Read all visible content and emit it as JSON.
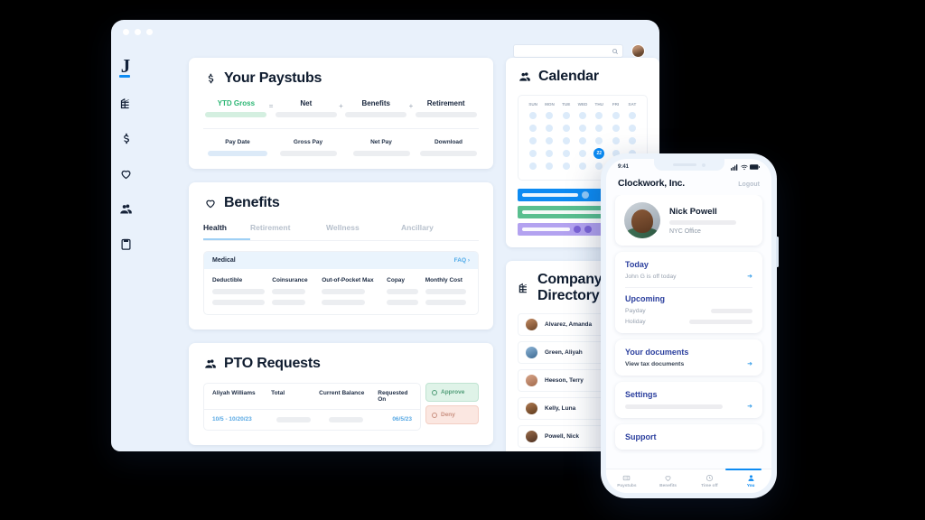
{
  "window": {
    "dots": 3
  },
  "sidebar": {
    "logo": "J",
    "items": [
      {
        "name": "company-icon",
        "label": "Company"
      },
      {
        "name": "payroll-icon",
        "label": "Payroll"
      },
      {
        "name": "benefits-icon",
        "label": "Benefits"
      },
      {
        "name": "time-off-icon",
        "label": "Time Off"
      },
      {
        "name": "documents-icon",
        "label": "Documents"
      }
    ]
  },
  "topbar": {
    "search_placeholder": "",
    "search_value": "",
    "search_icon": "search-icon",
    "avatar": "user-avatar"
  },
  "paystubs": {
    "icon": "dollar-icon",
    "title": "Your Paystubs",
    "summary": [
      {
        "label": "YTD Gross",
        "accent": "green",
        "op": ""
      },
      {
        "label": "Net",
        "accent": "",
        "op": "="
      },
      {
        "label": "Benefits",
        "accent": "",
        "op": "+"
      },
      {
        "label": "Retirement",
        "accent": "",
        "op": "+"
      }
    ],
    "table_headers": [
      "Pay Date",
      "Gross Pay",
      "Net Pay",
      "Download"
    ]
  },
  "benefits": {
    "icon": "heart-icon",
    "title": "Benefits",
    "tabs": [
      {
        "label": "Health",
        "active": true
      },
      {
        "label": "Retirement",
        "active": false
      },
      {
        "label": "Wellness",
        "active": false
      },
      {
        "label": "Ancillary",
        "active": false
      }
    ],
    "plan_row": {
      "name": "Medical",
      "faq": "FAQ",
      "chevron": "chevron-right-icon"
    },
    "columns": [
      "Deductible",
      "Coinsurance",
      "Out-of-Pocket Max",
      "Copay",
      "Monthly Cost"
    ]
  },
  "pto": {
    "icon": "pto-icon",
    "title": "PTO Requests",
    "headers": [
      "Aliyah Williams",
      "Total",
      "Current Balance",
      "Requested On"
    ],
    "row": {
      "dates": "10/5 - 10/20/23",
      "total": "",
      "balance": "",
      "requested_on": "06/5/23"
    },
    "approve_label": "Approve",
    "deny_label": "Deny"
  },
  "calendar": {
    "icon": "calendar-people-icon",
    "title": "Calendar",
    "dow": [
      "SUN",
      "MON",
      "TUE",
      "WED",
      "THU",
      "FRI",
      "SAT"
    ],
    "today": "22",
    "today_index": 25,
    "cells": 35,
    "events": [
      {
        "color": "#0d8bf2",
        "pips": 1
      },
      {
        "color": "#59bf8f",
        "pips": 0
      },
      {
        "color": "#b3a2f0",
        "pips": 2
      }
    ]
  },
  "directory": {
    "icon": "building-icon",
    "title": "Company Directory",
    "people": [
      {
        "name": "Alvarez, Amanda",
        "av1": "#c28a62",
        "av2": "#6d4527"
      },
      {
        "name": "Green, Aliyah",
        "av1": "#8fb6d8",
        "av2": "#3d6a92"
      },
      {
        "name": "Heeson, Terry",
        "av1": "#d9a68a",
        "av2": "#a26a4c"
      },
      {
        "name": "Kelly, Luna",
        "av1": "#b07b52",
        "av2": "#5e3a1d"
      },
      {
        "name": "Powell, Nick",
        "av1": "#9a6c4a",
        "av2": "#4e3121"
      }
    ]
  },
  "phone": {
    "status": {
      "time": "9:41",
      "signal_icon": "cellular-icon",
      "wifi_icon": "wifi-icon",
      "battery_icon": "battery-icon"
    },
    "header": {
      "company": "Clockwork, Inc.",
      "logout": "Logout"
    },
    "profile": {
      "name": "Nick Powell",
      "office": "NYC Office",
      "avatar": "profile-photo"
    },
    "today": {
      "title": "Today",
      "item": "John G is off today",
      "arrow": "arrow-right-icon"
    },
    "upcoming": {
      "title": "Upcoming",
      "items": [
        "Payday",
        "Holiday"
      ]
    },
    "documents": {
      "title": "Your documents",
      "item": "View tax documents",
      "arrow": "arrow-right-icon"
    },
    "settings": {
      "title": "Settings",
      "arrow": "arrow-right-icon"
    },
    "support": {
      "title": "Support"
    },
    "tabs": [
      {
        "label": "Paystubs",
        "icon": "paystub-icon",
        "active": false
      },
      {
        "label": "Benefits",
        "icon": "heart-icon",
        "active": false
      },
      {
        "label": "Time off",
        "icon": "clock-icon",
        "active": false
      },
      {
        "label": "You",
        "icon": "person-icon",
        "active": true
      }
    ]
  },
  "colors": {
    "accent_blue": "#0d8bf2",
    "accent_green": "#2bb673",
    "phone_heading": "#2b3f9e",
    "window_bg": "#E9F1FB",
    "page_bg": "#000000"
  }
}
